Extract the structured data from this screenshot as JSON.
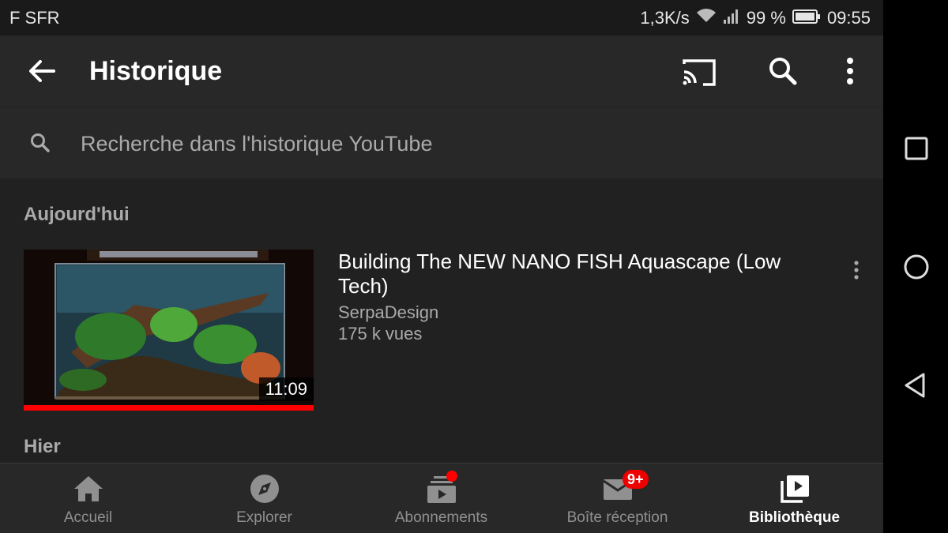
{
  "status_bar": {
    "carrier": "F SFR",
    "network_speed": "1,3K/s",
    "battery": "99 %",
    "time": "09:55"
  },
  "app_bar": {
    "title": "Historique",
    "icons": [
      "back-arrow-icon",
      "cast-icon",
      "search-icon",
      "more-vert-icon"
    ]
  },
  "history_search": {
    "placeholder": "Recherche dans l'historique YouTube"
  },
  "sections": {
    "today": "Aujourd'hui",
    "yesterday": "Hier"
  },
  "video": {
    "title": "Building The NEW NANO FISH Aquascape (Low Tech)",
    "channel": "SerpaDesign",
    "views": "175 k vues",
    "duration": "11:09",
    "watched_fraction": 1.0
  },
  "bottom_nav": {
    "items": [
      {
        "label": "Accueil",
        "icon": "home-icon"
      },
      {
        "label": "Explorer",
        "icon": "compass-icon"
      },
      {
        "label": "Abonnements",
        "icon": "subscriptions-icon"
      },
      {
        "label": "Boîte réception",
        "icon": "mail-icon",
        "badge": "9+"
      },
      {
        "label": "Bibliothèque",
        "icon": "library-icon",
        "active": true
      }
    ]
  },
  "colors": {
    "background": "#212121",
    "surface": "#282828",
    "accent_red": "#ff0000",
    "muted_text": "#aaaaaa"
  }
}
